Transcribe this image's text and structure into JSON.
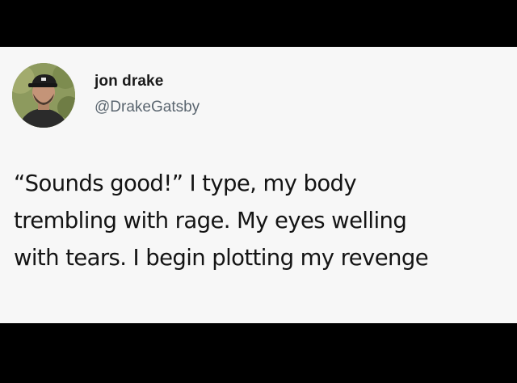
{
  "user": {
    "display_name": "jon drake",
    "handle": "@DrakeGatsby",
    "avatar_icon": "user-avatar-photo"
  },
  "tweet": {
    "lines": [
      "“Sounds good!” I type, my body",
      "trembling with rage. My eyes welling",
      "with tears. I begin plotting my revenge"
    ]
  },
  "colors": {
    "background": "#000000",
    "card": "#f7f7f7",
    "name": "#1a1a1a",
    "handle": "#5b6670",
    "text": "#141414"
  }
}
